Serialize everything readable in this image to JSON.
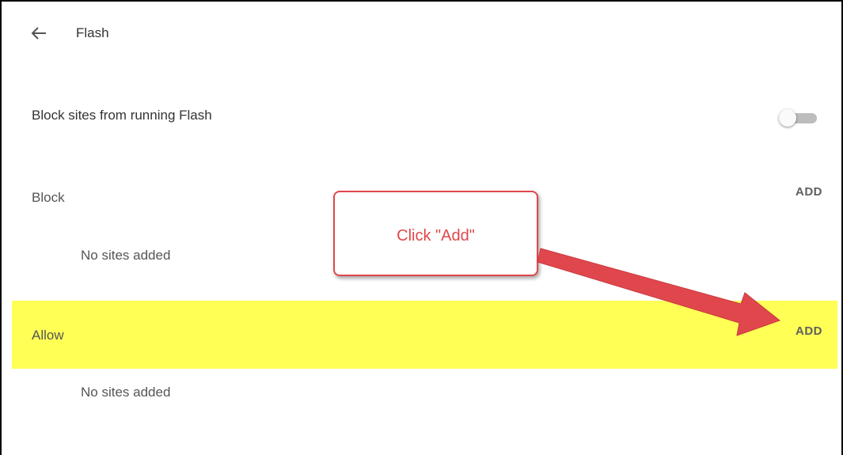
{
  "header": {
    "title": "Flash",
    "back_icon": "arrow-left-icon"
  },
  "toggle_row": {
    "label": "Block sites from running Flash",
    "enabled": false
  },
  "block_section": {
    "label": "Block",
    "add_label": "ADD",
    "empty_text": "No sites added"
  },
  "allow_section": {
    "label": "Allow",
    "add_label": "ADD",
    "empty_text": "No sites added"
  },
  "annotation": {
    "callout_text": "Click \"Add\"",
    "color": "#e0474c",
    "highlight_color": "#ffff55"
  }
}
